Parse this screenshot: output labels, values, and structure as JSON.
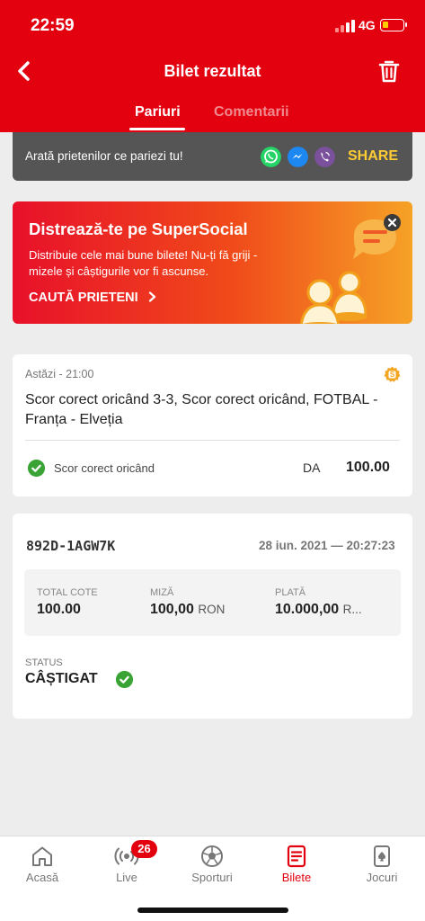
{
  "status_bar": {
    "time": "22:59",
    "network": "4G"
  },
  "header": {
    "title": "Bilet rezultat"
  },
  "tabs": [
    {
      "label": "Pariuri"
    },
    {
      "label": "Comentarii"
    }
  ],
  "share_bar": {
    "text": "Arată prietenilor ce pariezi tu!",
    "button": "SHARE"
  },
  "promo": {
    "title": "Distrează-te pe SuperSocial",
    "description": "Distribuie cele mai bune bilete! Nu-ți fă griji - mizele și câștigurile vor fi ascunse.",
    "cta": "CAUTĂ PRIETENI"
  },
  "bet": {
    "date": "Astăzi - 21:00",
    "title": "Scor corect oricând 3-3, Scor corect oricând, FOTBAL - Franța - Elveția",
    "market": "Scor corect oricând",
    "pick": "DA",
    "odd": "100.00"
  },
  "ticket": {
    "code": "892D-1AGW7K",
    "date": "28 iun. 2021 — 20:27:23",
    "total_cote_label": "TOTAL COTE",
    "total_cote_value": "100.00",
    "miza_label": "MIZĂ",
    "miza_value": "100,00",
    "miza_unit": "RON",
    "plata_label": "PLATĂ",
    "plata_value": "10.000,00",
    "plata_unit": "R...",
    "status_label": "STATUS",
    "status_value": "CÂȘTIGAT"
  },
  "bottom_nav": [
    {
      "label": "Acasă",
      "icon": "home-icon"
    },
    {
      "label": "Live",
      "icon": "live-icon",
      "badge": "26"
    },
    {
      "label": "Sporturi",
      "icon": "soccer-ball-icon"
    },
    {
      "label": "Bilete",
      "icon": "ticket-icon",
      "active": true
    },
    {
      "label": "Jocuri",
      "icon": "cards-icon"
    }
  ],
  "colors": {
    "brand_red": "#e3000f",
    "share_yellow": "#ffcc33",
    "success_green": "#3aa335"
  }
}
